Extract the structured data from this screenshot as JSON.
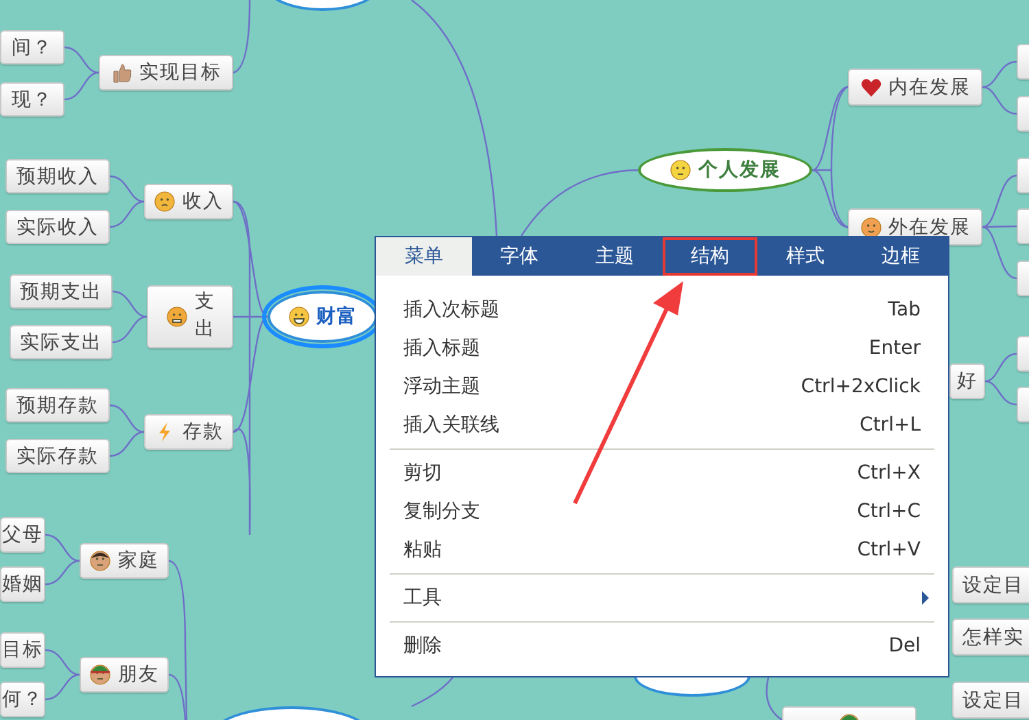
{
  "mind_map": {
    "nodes": [
      {
        "kind": "ellipse",
        "selected": false
      },
      {
        "kind": "box",
        "text": "间？",
        "selected": false
      },
      {
        "kind": "box",
        "text": "现？",
        "selected": false
      },
      {
        "kind": "box",
        "text": "实现目标",
        "selected": false
      },
      {
        "kind": "box",
        "text": "预期收入",
        "selected": false
      },
      {
        "kind": "box",
        "text": "实际收入",
        "selected": false
      },
      {
        "kind": "box",
        "text": "收入",
        "selected": false
      },
      {
        "kind": "box",
        "text": "预期支出",
        "selected": false
      },
      {
        "kind": "box",
        "text": "实际支出",
        "selected": false
      },
      {
        "kind": "box",
        "text": "支出",
        "selected": false
      },
      {
        "kind": "ellipse",
        "text": "财富",
        "selected": true
      },
      {
        "kind": "box",
        "text": "预期存款",
        "selected": false
      },
      {
        "kind": "box",
        "text": "实际存款",
        "selected": false
      },
      {
        "kind": "box",
        "text": "存款",
        "selected": false
      },
      {
        "kind": "box",
        "text": "父母",
        "selected": false
      },
      {
        "kind": "box",
        "text": "婚姻",
        "selected": false
      },
      {
        "kind": "box",
        "text": "家庭",
        "selected": false
      },
      {
        "kind": "box",
        "text": "目标",
        "selected": false
      },
      {
        "kind": "box",
        "text": "何？",
        "selected": false
      },
      {
        "kind": "box",
        "text": "朋友",
        "selected": false
      },
      {
        "kind": "ellipse",
        "selected": false
      },
      {
        "kind": "ellipse",
        "text": "个人发展",
        "selected": false
      },
      {
        "kind": "box",
        "text": "内在发展",
        "selected": false
      },
      {
        "kind": "box",
        "text": "外在发展",
        "selected": false
      },
      {
        "kind": "box",
        "selected": false
      },
      {
        "kind": "box",
        "selected": false
      },
      {
        "kind": "box",
        "selected": false
      },
      {
        "kind": "box",
        "selected": false
      },
      {
        "kind": "box",
        "selected": false
      },
      {
        "kind": "box",
        "text": "好",
        "selected": false
      },
      {
        "kind": "box",
        "selected": false
      },
      {
        "kind": "box",
        "selected": false
      },
      {
        "kind": "box",
        "text": "设定目",
        "selected": false
      },
      {
        "kind": "box",
        "text": "怎样实",
        "selected": false
      },
      {
        "kind": "box",
        "text": "设定目",
        "selected": false
      },
      {
        "kind": "box",
        "selected": false
      },
      {
        "kind": "ellipse",
        "selected": false
      }
    ]
  },
  "context_menu": {
    "tabs": [
      {
        "label": "菜单",
        "selected": true,
        "annotated": false
      },
      {
        "label": "字体",
        "selected": false,
        "annotated": false
      },
      {
        "label": "主题",
        "selected": false,
        "annotated": false
      },
      {
        "label": "结构",
        "selected": false,
        "annotated": true
      },
      {
        "label": "样式",
        "selected": false,
        "annotated": false
      },
      {
        "label": "边框",
        "selected": false,
        "annotated": false
      }
    ],
    "items": [
      {
        "kind": "item",
        "label": "插入次标题",
        "shortcut": "Tab"
      },
      {
        "kind": "item",
        "label": "插入标题",
        "shortcut": "Enter"
      },
      {
        "kind": "item",
        "label": "浮动主题",
        "shortcut": "Ctrl+2xClick"
      },
      {
        "kind": "item",
        "label": "插入关联线",
        "shortcut": "Ctrl+L"
      },
      {
        "kind": "separator"
      },
      {
        "kind": "item",
        "label": "剪切",
        "shortcut": "Ctrl+X"
      },
      {
        "kind": "item",
        "label": "复制分支",
        "shortcut": "Ctrl+C"
      },
      {
        "kind": "item",
        "label": "粘贴",
        "shortcut": "Ctrl+V"
      },
      {
        "kind": "separator"
      },
      {
        "kind": "submenu",
        "label": "工具"
      },
      {
        "kind": "separator"
      },
      {
        "kind": "item",
        "label": "删除",
        "shortcut": "Del"
      }
    ]
  }
}
